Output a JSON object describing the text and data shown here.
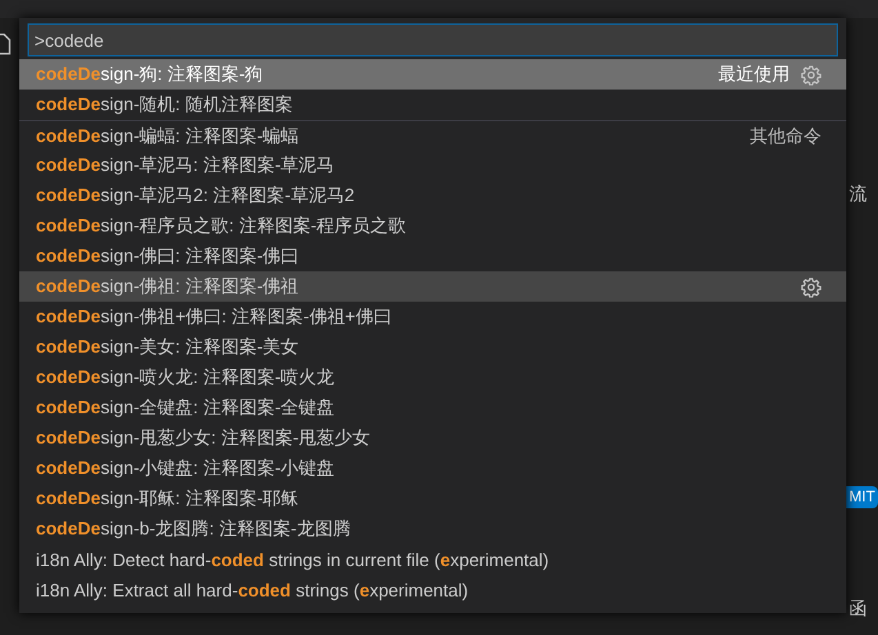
{
  "quick_open": {
    "input": {
      "value": ">codede"
    },
    "items": [
      {
        "label": "**codeDe**sign-狗: 注释图案-狗",
        "selected": true,
        "hovered": false,
        "group": "最近使用"
      },
      {
        "label": "**codeDe**sign-随机: 随机注释图案",
        "selected": false,
        "hovered": false
      },
      {
        "label": "**codeDe**sign-蝙蝠: 注释图案-蝙蝠",
        "selected": false,
        "hovered": false,
        "group": "其他命令"
      },
      {
        "label": "**codeDe**sign-草泥马: 注释图案-草泥马",
        "selected": false,
        "hovered": false
      },
      {
        "label": "**codeDe**sign-草泥马2: 注释图案-草泥马2",
        "selected": false,
        "hovered": false
      },
      {
        "label": "**codeDe**sign-程序员之歌: 注释图案-程序员之歌",
        "selected": false,
        "hovered": false
      },
      {
        "label": "**codeDe**sign-佛曰: 注释图案-佛曰",
        "selected": false,
        "hovered": false
      },
      {
        "label": "**codeDe**sign-佛祖: 注释图案-佛祖",
        "selected": false,
        "hovered": true
      },
      {
        "label": "**codeDe**sign-佛祖+佛曰: 注释图案-佛祖+佛曰",
        "selected": false,
        "hovered": false
      },
      {
        "label": "**codeDe**sign-美女: 注释图案-美女",
        "selected": false,
        "hovered": false
      },
      {
        "label": "**codeDe**sign-喷火龙: 注释图案-喷火龙",
        "selected": false,
        "hovered": false
      },
      {
        "label": "**codeDe**sign-全键盘: 注释图案-全键盘",
        "selected": false,
        "hovered": false
      },
      {
        "label": "**codeDe**sign-甩葱少女: 注释图案-甩葱少女",
        "selected": false,
        "hovered": false
      },
      {
        "label": "**codeDe**sign-小键盘: 注释图案-小键盘",
        "selected": false,
        "hovered": false
      },
      {
        "label": "**codeDe**sign-耶稣: 注释图案-耶稣",
        "selected": false,
        "hovered": false
      },
      {
        "label": "**codeDe**sign-b-龙图腾: 注释图案-龙图腾",
        "selected": false,
        "hovered": false
      },
      {
        "label": "i18n Ally: Detect hard-**coded** strings in current file (**e**xperimental)",
        "selected": false,
        "hovered": false
      },
      {
        "label": "i18n Ally: Extract all hard-**coded** strings (**e**xperimental)",
        "selected": false,
        "hovered": false
      }
    ]
  },
  "editor_background": {
    "texts": [
      "流",
      "函"
    ],
    "badge": "MIT"
  }
}
